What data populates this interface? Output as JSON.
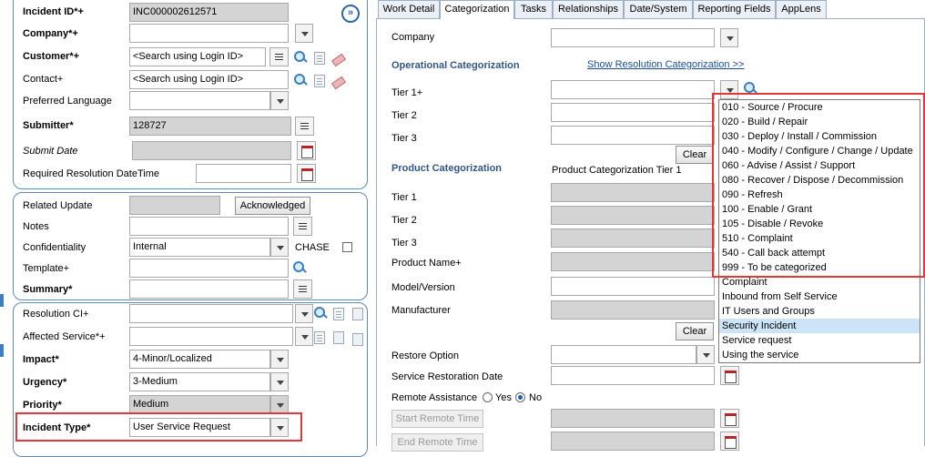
{
  "left": {
    "incident_id": {
      "label": "Incident ID*+",
      "value": "INC000002612571"
    },
    "company": {
      "label": "Company*+",
      "value": ""
    },
    "customer": {
      "label": "Customer*+",
      "placeholder": "<Search using Login ID>"
    },
    "contact": {
      "label": "Contact+",
      "placeholder": "<Search using Login ID>"
    },
    "preferred_language": {
      "label": "Preferred Language",
      "value": ""
    },
    "submitter": {
      "label": "Submitter*",
      "value": "128727"
    },
    "submit_date": {
      "label": "Submit Date",
      "value": ""
    },
    "required_resolution": {
      "label": "Required Resolution DateTime",
      "value": ""
    },
    "related_update": {
      "label": "Related Update",
      "button": "Acknowledged"
    },
    "notes": {
      "label": "Notes",
      "value": ""
    },
    "confidentiality": {
      "label": "Confidentiality",
      "value": "Internal",
      "chase_label": "CHASE"
    },
    "template": {
      "label": "Template+",
      "value": ""
    },
    "summary": {
      "label": "Summary*",
      "value": ""
    },
    "resolution_ci": {
      "label": "Resolution CI+",
      "value": ""
    },
    "affected_service": {
      "label": "Affected Service*+",
      "value": ""
    },
    "impact": {
      "label": "Impact*",
      "value": "4-Minor/Localized"
    },
    "urgency": {
      "label": "Urgency*",
      "value": "3-Medium"
    },
    "priority": {
      "label": "Priority*",
      "value": "Medium"
    },
    "incident_type": {
      "label": "Incident Type*",
      "value": "User Service Request"
    },
    "expand_symbol": "»"
  },
  "tabs": [
    "Work Detail",
    "Categorization",
    "Tasks",
    "Relationships",
    "Date/System",
    "Reporting Fields",
    "AppLens"
  ],
  "right": {
    "company_label": "Company",
    "op_cat_title": "Operational Categorization",
    "show_res_link": "Show Resolution Categorization >>",
    "tier1": "Tier 1+",
    "tier2": "Tier 2",
    "tier3": "Tier 3",
    "clear": "Clear",
    "prod_cat_title": "Product Categorization",
    "prod_cat_tier1_header": "Product Categorization Tier 1",
    "ptier1": "Tier 1",
    "ptier2": "Tier 2",
    "ptier3": "Tier 3",
    "product_name": "Product Name+",
    "model_version": "Model/Version",
    "manufacturer": "Manufacturer",
    "restore_option": "Restore Option",
    "service_restoration_date": "Service Restoration Date",
    "remote_assistance": "Remote Assistance",
    "yes": "Yes",
    "no": "No",
    "start_remote": "Start Remote Time",
    "end_remote": "End Remote Time"
  },
  "tier1_dropdown": [
    "010 - Source / Procure",
    "020 - Build / Repair",
    "030 - Deploy / Install / Commission",
    "040 - Modify / Configure / Change / Update",
    "060 - Advise / Assist / Support",
    "080 - Recover / Dispose / Decommission",
    "090 - Refresh",
    "100 - Enable / Grant",
    "105 - Disable / Revoke",
    "510 - Complaint",
    "540 - Call back attempt",
    "999 - To be categorized",
    "Complaint",
    "Inbound from Self Service",
    "IT Users and Groups",
    "Security Incident",
    "Service request",
    "Using the service"
  ],
  "highlight_color": "#e0393b",
  "selected_item": "Security Incident"
}
